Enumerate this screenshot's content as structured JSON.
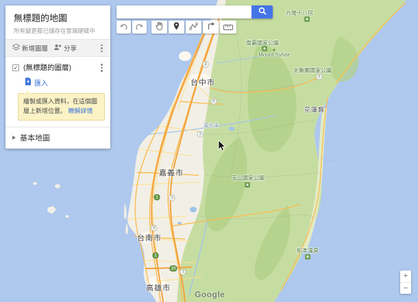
{
  "panel": {
    "title": "無標題的地圖",
    "subtitle": "所有變更都已儲存在雲端硬碟中",
    "add_layer_label": "新增圖層",
    "share_label": "分享",
    "layer_name": "(無標題的圖層)",
    "import_label": "匯入",
    "tip_text": "繪製或匯入資料，在這個圖層上新增位置。",
    "tip_link": "瞭解詳情",
    "base_map_label": "基本地圖"
  },
  "search": {
    "value": "",
    "button_icon": "search-magnifier"
  },
  "edit_toolbar": {
    "buttons": [
      "undo",
      "redo",
      "pan-hand",
      "add-marker",
      "draw-line",
      "add-directions",
      "measure-ruler"
    ]
  },
  "zoom_control": {
    "zoom_in": "+",
    "zoom_out": "−"
  },
  "map": {
    "logo": "Google",
    "labels": [
      {
        "text": "台中市",
        "type": "city"
      },
      {
        "text": "嘉義市",
        "type": "city"
      },
      {
        "text": "台南市",
        "type": "city"
      },
      {
        "text": "高雄市",
        "type": "city"
      },
      {
        "text": "花蓮縣",
        "type": "county"
      },
      {
        "text": "雪霸國家公園",
        "type": "park"
      },
      {
        "text": "Mount Sylvia",
        "type": "park"
      },
      {
        "text": "太魯閣國家公園",
        "type": "park"
      },
      {
        "text": "玉山國家公園",
        "type": "park"
      },
      {
        "text": "濁水溪",
        "type": "water"
      },
      {
        "text": "九彎十八拐",
        "type": "park"
      },
      {
        "text": "知本溫泉",
        "type": "park"
      }
    ],
    "route_shields": [
      {
        "num": "4"
      },
      {
        "num": "6"
      },
      {
        "num": "3"
      },
      {
        "num": "1"
      },
      {
        "num": "3"
      },
      {
        "num": "8"
      },
      {
        "num": "1"
      },
      {
        "num": "10"
      },
      {
        "num": "3"
      },
      {
        "num": "8"
      }
    ],
    "park_badge_glyph": "▲",
    "peak_glyph": "▲"
  },
  "colors": {
    "sea": "#aec8ee",
    "plain": "#f2efe6",
    "mountain": "#c6dda2",
    "highway_orange": "#f3a23c",
    "road_orange": "#f9bd55",
    "search_blue": "#4475e7",
    "link_blue": "#3b73d9",
    "tip_yellow": "#fbf3c6"
  }
}
